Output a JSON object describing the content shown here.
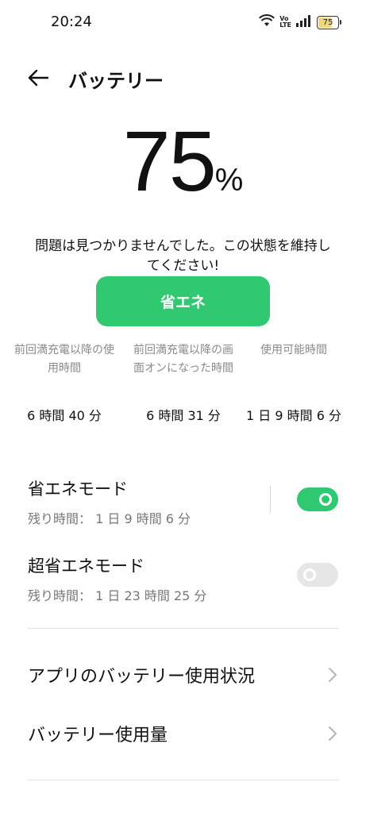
{
  "status_bar": {
    "time": "20:24",
    "icons": [
      "wifi-icon",
      "volte-icon",
      "signal-icon",
      "battery-icon"
    ],
    "volte_top": "Vo",
    "volte_bottom": "LTE",
    "battery_level": "75"
  },
  "header": {
    "back_icon": "arrow-left-icon",
    "title": "バッテリー"
  },
  "battery": {
    "percent": "75",
    "unit": "%",
    "message": "問題は見つかりませんでした。この状態を維持してください!"
  },
  "power_save_button": {
    "label": "省エネ",
    "color": "#31c872"
  },
  "stats": [
    {
      "label": "前回満充電以降の使用時間",
      "value": "6 時間 40 分"
    },
    {
      "label": "前回満充電以降の画面オンになった時間",
      "value": "6 時間 31 分"
    },
    {
      "label": "使用可能時間",
      "value": "1 日 9 時間 6 分"
    }
  ],
  "modes": [
    {
      "title": "省エネモード",
      "subtitle": "残り時間： 1 日 9 時間 6 分",
      "enabled": true
    },
    {
      "title": "超省エネモード",
      "subtitle": "残り時間： 1 日 23 時間 25 分",
      "enabled": false
    }
  ],
  "nav_items": [
    {
      "label": "アプリのバッテリー使用状況",
      "icon": "chevron-right-icon"
    },
    {
      "label": "バッテリー使用量",
      "icon": "chevron-right-icon"
    }
  ],
  "colors": {
    "accent": "#31c872",
    "toggle_off": "#e6e6e6",
    "secondary_text": "#8a8a8a"
  }
}
